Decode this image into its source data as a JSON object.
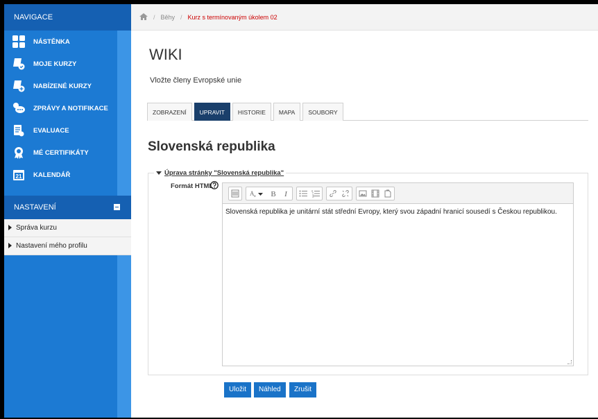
{
  "nav": {
    "header": "NAVIGACE",
    "items": [
      {
        "label": "NÁSTĚNKA",
        "icon": "dashboard-icon"
      },
      {
        "label": "MOJE KURZY",
        "icon": "my-courses-icon"
      },
      {
        "label": "NABÍZENÉ KURZY",
        "icon": "offered-courses-icon"
      },
      {
        "label": "ZPRÁVY A NOTIFIKACE",
        "icon": "messages-icon"
      },
      {
        "label": "EVALUACE",
        "icon": "evaluation-icon"
      },
      {
        "label": "MÉ CERTIFIKÁTY",
        "icon": "certificate-icon"
      },
      {
        "label": "KALENDÁŘ",
        "icon": "calendar-icon",
        "day": "21"
      }
    ]
  },
  "settings": {
    "header": "NASTAVENÍ",
    "items": [
      {
        "label": "Správa kurzu"
      },
      {
        "label": "Nastavení mého profilu"
      }
    ]
  },
  "breadcrumb": {
    "items": [
      "Běhy",
      "Kurz s termínovaným úkolem 02"
    ]
  },
  "page": {
    "title": "WIKI",
    "intro": "Vložte členy Evropské unie",
    "tabs": [
      {
        "label": "ZOBRAZENÍ",
        "active": false
      },
      {
        "label": "UPRAVIT",
        "active": true
      },
      {
        "label": "HISTORIE",
        "active": false
      },
      {
        "label": "MAPA",
        "active": false
      },
      {
        "label": "SOUBORY",
        "active": false
      }
    ],
    "section_heading": "Slovenská republika",
    "legend": "Úprava stránky \"Slovenská republika\"",
    "field_label": "Formát HTML",
    "editor_text": "Slovenská republika je unitární stát střední Evropy, který svou západní hranicí sousedí s Českou republikou.",
    "buttons": {
      "save": "Uložit",
      "preview": "Náhled",
      "cancel": "Zrušit"
    }
  },
  "colors": {
    "sidebar": "#1c7ad3",
    "sidebar_header": "#1560b2",
    "active_tab": "#1a3f6b",
    "button": "#1a73c8",
    "breadcrumb_current": "#cc0000"
  }
}
